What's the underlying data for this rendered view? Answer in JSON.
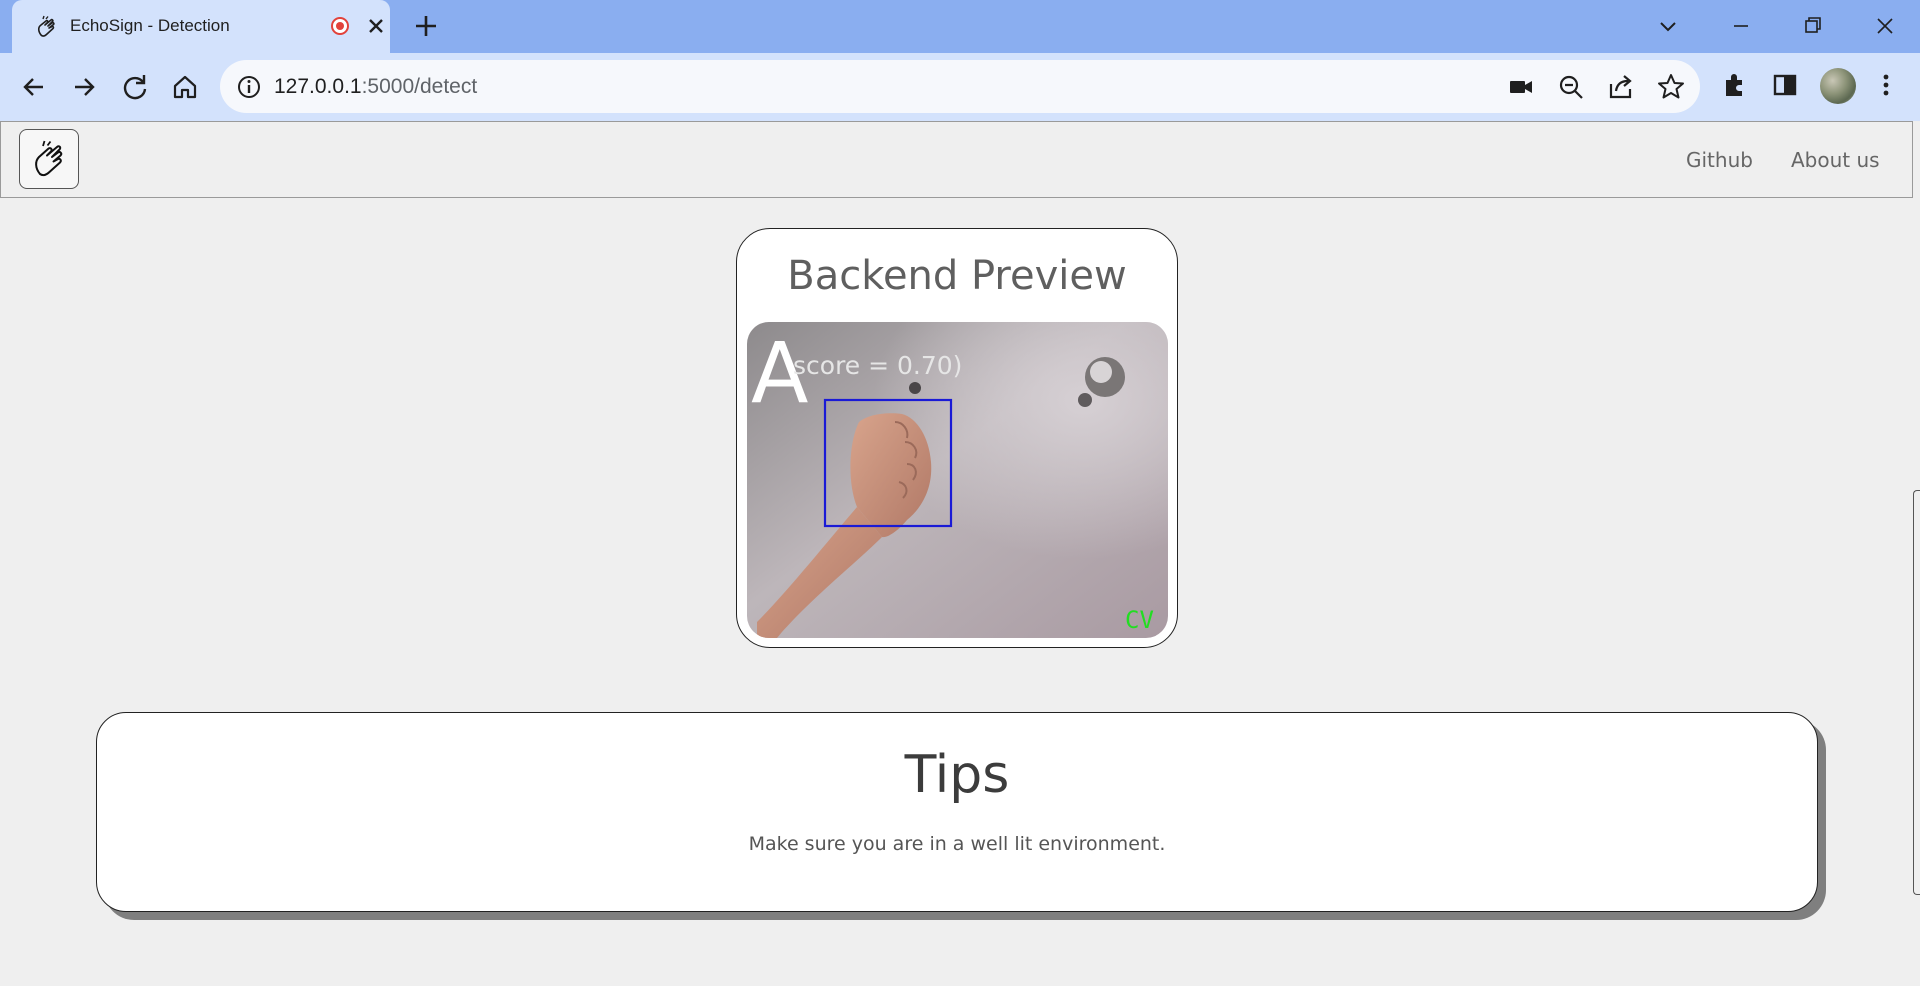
{
  "browser": {
    "tab_title": "EchoSign - Detection",
    "url_host": "127.0.0.1",
    "url_path": ":5000/detect"
  },
  "navbar": {
    "links": [
      {
        "label": "Github"
      },
      {
        "label": "About us"
      }
    ]
  },
  "preview": {
    "title": "Backend Preview",
    "detected_letter": "A",
    "score_text": "score = 0.70)",
    "watermark": "CV"
  },
  "tips": {
    "title": "Tips",
    "text": "Make sure you are in a well lit environment."
  },
  "colors": {
    "tabstrip": "#8aaef0",
    "toolbar": "#d3e2fc",
    "page_bg": "#efefef",
    "bbox": "#1a1ad6",
    "watermark": "#22dd22"
  }
}
